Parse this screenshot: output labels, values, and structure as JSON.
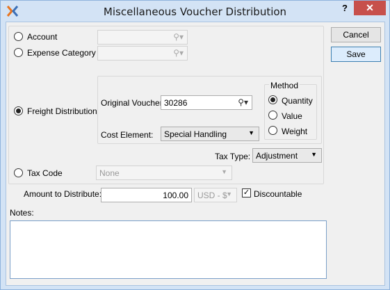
{
  "window": {
    "title": "Miscellaneous Voucher Distribution",
    "help_label": "?",
    "close_label": "✕"
  },
  "distribution_type": {
    "account_label": "Account",
    "expense_category_label": "Expense Category",
    "freight_distribution_label": "Freight Distribution",
    "tax_code_label": "Tax Code",
    "selected": "Freight Distribution"
  },
  "freight": {
    "original_voucher_label": "Original Voucher:",
    "original_voucher_value": "30286",
    "cost_element_label": "Cost Element:",
    "cost_element_value": "Special Handling",
    "method": {
      "title": "Method",
      "quantity_label": "Quantity",
      "value_label": "Value",
      "weight_label": "Weight",
      "selected": "Quantity"
    }
  },
  "tax_type": {
    "label": "Tax Type:",
    "value": "Adjustment"
  },
  "tax_code": {
    "value": "None"
  },
  "amount": {
    "label": "Amount to Distribute:",
    "value": "100.00",
    "currency": "USD - $",
    "discountable_label": "Discountable",
    "discountable_checked": true
  },
  "notes": {
    "label": "Notes:",
    "value": ""
  },
  "buttons": {
    "cancel_label": "Cancel",
    "save_label": "Save"
  },
  "icons": {
    "app": "xtuple-x-icon",
    "search": "search-magnifier-icon",
    "dropdown": "chevron-down-icon"
  },
  "colors": {
    "title_bar": "#d3e3f5",
    "close_button": "#c7504b",
    "app_icon_orange": "#e8741e",
    "app_icon_blue": "#3b6fb6"
  }
}
